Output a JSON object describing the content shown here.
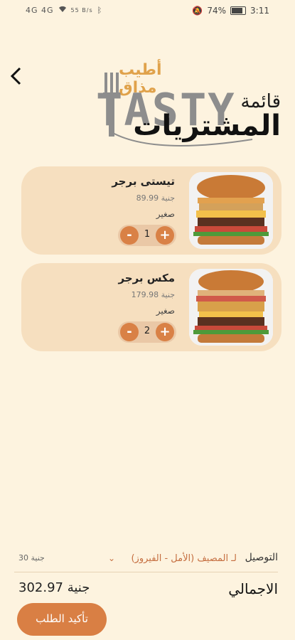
{
  "status_bar": {
    "network": "4G 4G",
    "speed": "55 B/s",
    "battery": "74%",
    "time": "3:11"
  },
  "header": {
    "back_icon": "chevron-left-icon",
    "logo_tagline": "أطيب مذاق",
    "logo_text": "TASTY",
    "title_line1": "قائمة",
    "title_line2": "المشتريات"
  },
  "cart": {
    "items": [
      {
        "name": "تيستى برجر",
        "price": "89.99 جنية",
        "size": "صغير",
        "quantity": "1"
      },
      {
        "name": "مكس برجر",
        "price": "179.98 جنية",
        "size": "صغير",
        "quantity": "2"
      }
    ]
  },
  "summary": {
    "delivery_label": "التوصيل",
    "delivery_area": "لـ المصيف (الأمل - الفيروز)",
    "delivery_fee": "30 جنية",
    "total_label": "الاجمالي",
    "total_value": "302.97 جنية",
    "confirm_label": "تأكيد الطلب"
  },
  "colors": {
    "background": "#fdf3df",
    "card": "#f6dfbf",
    "accent": "#d97f44"
  }
}
